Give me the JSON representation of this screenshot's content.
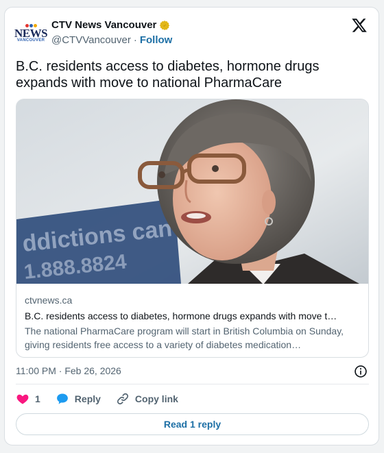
{
  "account": {
    "display_name": "CTV News Vancouver",
    "handle": "@CTVVancouver",
    "separator": "·",
    "follow_label": "Follow",
    "avatar_main": "NEWS",
    "avatar_sub": "VANCOUVER"
  },
  "tweet": {
    "text": "B.C. residents access to diabetes, hormone drugs expands with move to national PharmaCare"
  },
  "link_card": {
    "domain": "ctvnews.ca",
    "title": "B.C. residents access to diabetes, hormone drugs expands with move t…",
    "description": "The national PharmaCare program will start in British Columbia on Sunday, giving residents free access to a variety of diabetes medication…",
    "image_alt": "Woman with glasses speaking at a podium",
    "sign_text_1": "ddictions can",
    "sign_text_2": "1.888.8824"
  },
  "meta": {
    "timestamp": "11:00 PM · Feb 26, 2026"
  },
  "actions": {
    "like_count": "1",
    "reply_label": "Reply",
    "copy_link_label": "Copy link"
  },
  "footer": {
    "read_reply_label": "Read 1 reply"
  },
  "colors": {
    "accent": "#1d6fa5",
    "like": "#f91880",
    "reply_icon": "#1d9bf0",
    "verified": "#e2b719"
  },
  "icons": {
    "verified": "verified-gold-badge-icon",
    "x_logo": "x-logo-icon",
    "info": "info-icon",
    "heart": "heart-icon",
    "reply": "speech-bubble-icon",
    "link": "link-icon"
  }
}
